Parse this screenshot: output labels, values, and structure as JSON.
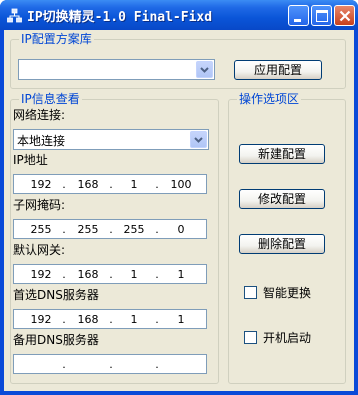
{
  "window": {
    "title": "IP切换精灵-1.0 Final-Fixd"
  },
  "scheme_group": {
    "title": "IP配置方案库",
    "combo_value": "",
    "apply_label": "应用配置"
  },
  "info_group": {
    "title": "IP信息查看",
    "network_label": "网络连接:",
    "network_value": "本地连接",
    "ip_label": "IP地址",
    "ip": [
      "192",
      "168",
      "1",
      "100"
    ],
    "mask_label": "子网掩码:",
    "mask": [
      "255",
      "255",
      "255",
      "0"
    ],
    "gateway_label": "默认网关:",
    "gateway": [
      "192",
      "168",
      "1",
      "1"
    ],
    "dns1_label": "首选DNS服务器",
    "dns1": [
      "192",
      "168",
      "1",
      "1"
    ],
    "dns2_label": "备用DNS服务器",
    "dns2": [
      "",
      "",
      "",
      ""
    ]
  },
  "ops_group": {
    "title": "操作选项区",
    "new_label": "新建配置",
    "modify_label": "修改配置",
    "delete_label": "删除配置",
    "smart_label": "智能更换",
    "smart_checked": false,
    "startup_label": "开机启动",
    "startup_checked": false
  },
  "dot": "."
}
